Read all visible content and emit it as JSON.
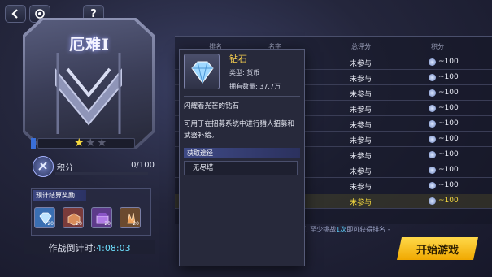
{
  "top_buttons": {
    "back": "back",
    "home": "home",
    "help": "?"
  },
  "rank": {
    "title": "厄难I",
    "stars_filled": 1,
    "stars_total": 3
  },
  "score": {
    "label": "积分",
    "value": "0/100"
  },
  "rewards": {
    "label": "预计结算奖励",
    "items": [
      {
        "icon": "diamond-icon",
        "count": "20",
        "color": "#3a6fb3"
      },
      {
        "icon": "crate-icon",
        "count": "20",
        "color": "#7a3b3b"
      },
      {
        "icon": "chest-icon",
        "count": "20",
        "color": "#5d3b8a"
      },
      {
        "icon": "crystal-icon",
        "count": "20",
        "color": "#6b4a2f"
      }
    ]
  },
  "countdown": {
    "label": "作战倒计时:",
    "time": "4:08:03"
  },
  "leaderboard": {
    "headers": {
      "rank": "排名",
      "name": "名字",
      "total": "总评分",
      "points": "积分"
    },
    "rows": [
      {
        "status": "未参与",
        "points": "~100"
      },
      {
        "status": "未参与",
        "points": "~100"
      },
      {
        "status": "未参与",
        "points": "~100"
      },
      {
        "status": "未参与",
        "points": "~100"
      },
      {
        "status": "未参与",
        "points": "~100"
      },
      {
        "status": "未参与",
        "points": "~100"
      },
      {
        "status": "未参与",
        "points": "~100"
      },
      {
        "status": "未参与",
        "points": "~100"
      },
      {
        "status": "未参与",
        "points": "~100"
      },
      {
        "status": "未参与",
        "points": "~100",
        "me": true
      }
    ],
    "footnote_pre": "区, 至少挑战",
    "footnote_num": "1次",
    "footnote_post": "即可获得排名 -"
  },
  "start_button": "开始游戏",
  "tooltip": {
    "name": "钻石",
    "type_line": "类型: 货币",
    "owned_line": "拥有数量: 37.7万",
    "desc1": "闪耀着光芒的钻石",
    "desc2": "可用于在招募系统中进行猎人招募和武器补给。",
    "source_label": "获取途径",
    "source_item": "无尽塔"
  },
  "colors": {
    "accent": "#f5cd4f",
    "highlight": "#5ed1ff",
    "start": "#ffc21c"
  }
}
